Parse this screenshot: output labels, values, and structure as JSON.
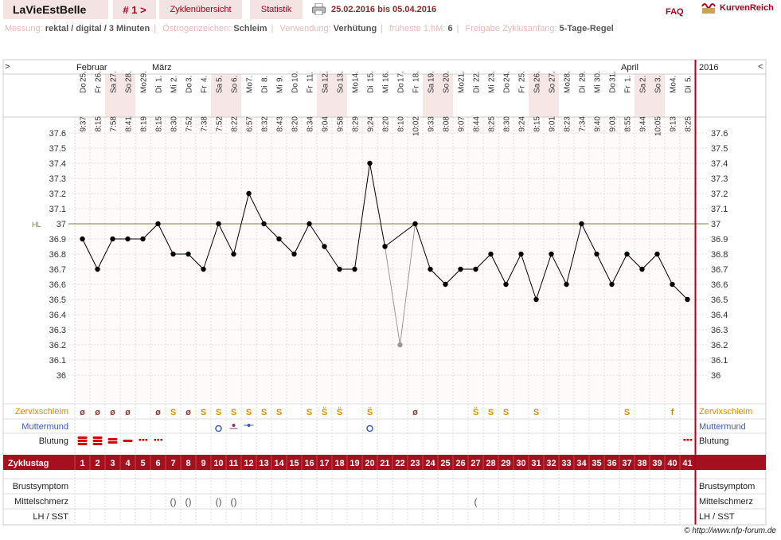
{
  "topbar": {
    "user": "LaVieEstBelle",
    "cycle_nav": "# 1 >",
    "tab_overview": "Zyklenübersicht",
    "tab_stats": "Statistik",
    "date_range": "25.02.2016 bis 05.04.2016",
    "faq": "FAQ",
    "brand": "KurvenReich"
  },
  "info": {
    "measure_label": "Messung:",
    "measure_value": "rektal / digital / 3 Minuten",
    "estrogen_label": "Östrogenzeichen:",
    "estrogen_value": "Schleim",
    "usage_label": "Verwendung:",
    "usage_value": "Verhütung",
    "earliest_label": "früheste 1.hM:",
    "earliest_value": "6",
    "release_label": "Freigabe Zyklusanfang:",
    "release_value": "5-Tage-Regel"
  },
  "nav": {
    "left": ">",
    "right": "<"
  },
  "year": "2016",
  "colors": {
    "accent": "#b0001e",
    "band": "#a5101e",
    "coverline": "#6b8e23",
    "weekend": "#f7e6e6"
  },
  "chart_data": {
    "type": "line",
    "months": [
      {
        "label": "Februar",
        "day": 1
      },
      {
        "label": "März",
        "day": 6
      },
      {
        "label": "April",
        "day": 37
      }
    ],
    "days": [
      {
        "d": "25.",
        "w": "Do",
        "t": "9:37"
      },
      {
        "d": "26.",
        "w": "Fr",
        "t": "8:15"
      },
      {
        "d": "27.",
        "w": "Sa",
        "t": "7:58"
      },
      {
        "d": "28.",
        "w": "So",
        "t": "8:41"
      },
      {
        "d": "29.",
        "w": "Mo",
        "t": "8:19"
      },
      {
        "d": "1.",
        "w": "Di",
        "t": "8:15"
      },
      {
        "d": "2.",
        "w": "Mi",
        "t": "8:30"
      },
      {
        "d": "3.",
        "w": "Do",
        "t": "7:52"
      },
      {
        "d": "4.",
        "w": "Fr",
        "t": "7:38"
      },
      {
        "d": "5.",
        "w": "Sa",
        "t": "7:52"
      },
      {
        "d": "6.",
        "w": "So",
        "t": "8:22"
      },
      {
        "d": "7.",
        "w": "Mo",
        "t": "6:57"
      },
      {
        "d": "8.",
        "w": "Di",
        "t": "8:32"
      },
      {
        "d": "9.",
        "w": "Mi",
        "t": "8:43"
      },
      {
        "d": "10.",
        "w": "Do",
        "t": "8:20"
      },
      {
        "d": "11.",
        "w": "Fr",
        "t": "8:34"
      },
      {
        "d": "12.",
        "w": "Sa",
        "t": "9:04"
      },
      {
        "d": "13.",
        "w": "So",
        "t": "9:58"
      },
      {
        "d": "14.",
        "w": "Mo",
        "t": "8:29"
      },
      {
        "d": "15.",
        "w": "Di",
        "t": "9:24"
      },
      {
        "d": "16.",
        "w": "Mi",
        "t": "8:20"
      },
      {
        "d": "17.",
        "w": "Do",
        "t": "8:10"
      },
      {
        "d": "18.",
        "w": "Fr",
        "t": "10:02"
      },
      {
        "d": "19.",
        "w": "Sa",
        "t": "9:33"
      },
      {
        "d": "20.",
        "w": "So",
        "t": "8:08"
      },
      {
        "d": "21.",
        "w": "Mo",
        "t": "9:07"
      },
      {
        "d": "22.",
        "w": "Di",
        "t": "8:44"
      },
      {
        "d": "23.",
        "w": "Mi",
        "t": "8:25"
      },
      {
        "d": "24.",
        "w": "Do",
        "t": "8:30"
      },
      {
        "d": "25.",
        "w": "Fr",
        "t": "9:24"
      },
      {
        "d": "26.",
        "w": "Sa",
        "t": "8:15"
      },
      {
        "d": "27.",
        "w": "So",
        "t": "9:01"
      },
      {
        "d": "28.",
        "w": "Mo",
        "t": "8:23"
      },
      {
        "d": "29.",
        "w": "Di",
        "t": "7:34"
      },
      {
        "d": "30.",
        "w": "Mi",
        "t": "9:40"
      },
      {
        "d": "31.",
        "w": "Do",
        "t": "9:03"
      },
      {
        "d": "1.",
        "w": "Fr",
        "t": "8:55"
      },
      {
        "d": "2.",
        "w": "Sa",
        "t": "9:44"
      },
      {
        "d": "3.",
        "w": "So",
        "t": "10:05"
      },
      {
        "d": "4.",
        "w": "Mo",
        "t": "9:13"
      },
      {
        "d": "5.",
        "w": "Di",
        "t": "8:25"
      }
    ],
    "temps": [
      36.9,
      36.7,
      36.9,
      36.9,
      36.9,
      37.0,
      36.8,
      36.8,
      36.7,
      37.0,
      36.8,
      37.2,
      37.0,
      36.9,
      36.8,
      37.0,
      36.85,
      36.7,
      36.7,
      37.4,
      36.85,
      36.2,
      37.0,
      36.7,
      36.6,
      36.7,
      36.7,
      36.8,
      36.6,
      36.8,
      36.5,
      36.8,
      36.6,
      37.0,
      36.8,
      36.6,
      36.8,
      36.7,
      36.8,
      36.6,
      36.5
    ],
    "excluded_day": 22,
    "cover_line": 37.0,
    "cover_label": "HL",
    "ylim": [
      36.0,
      37.6
    ],
    "yticks": [
      "37.6",
      "37.5",
      "37.4",
      "37.3",
      "37.2",
      "37.1",
      "37",
      "36.9",
      "36.8",
      "36.7",
      "36.6",
      "36.5",
      "36.4",
      "36.3",
      "36.2",
      "36.1",
      "36"
    ],
    "rows": {
      "mucus_label": "Zervixschleim",
      "cervix_label": "Muttermund",
      "bleed_label": "Blutung",
      "cycleday_label": "Zyklustag",
      "breast_label": "Brustsymptom",
      "midpain_label": "Mittelschmerz",
      "lh_label": "LH / SST"
    },
    "mucus": [
      "ø",
      "ø",
      "ø",
      "ø",
      "",
      "ø",
      "S",
      "ø",
      "S",
      "S",
      "S",
      "S",
      "S",
      "S",
      "",
      "S",
      "S̈",
      "S̈",
      "",
      "S̈",
      "",
      "",
      "ø",
      "",
      "",
      "",
      "S̈",
      "S",
      "S",
      "",
      "S",
      "",
      "",
      "",
      "",
      "",
      "S",
      "",
      "",
      "f"
    ],
    "bleed": [
      3,
      3,
      2,
      1,
      "dots",
      "dots",
      "",
      "",
      "",
      "",
      "",
      "",
      "",
      "",
      "",
      "",
      "",
      "",
      "",
      "",
      "",
      "",
      "",
      "",
      "",
      "",
      "",
      "",
      "",
      "",
      "",
      "",
      "",
      "",
      "",
      "",
      "",
      "",
      "",
      "",
      "dots"
    ],
    "midpain": [
      "",
      "",
      "",
      "",
      "",
      "",
      "()",
      "()",
      "",
      "()",
      "()",
      "",
      "",
      "",
      "",
      "",
      "",
      "",
      "",
      "",
      "",
      "",
      "",
      "",
      "",
      "",
      "(",
      "",
      "",
      "",
      "",
      "",
      "",
      "",
      "",
      "",
      "",
      "",
      "",
      "",
      ""
    ]
  },
  "footer": "© http://www.nfp-forum.de"
}
